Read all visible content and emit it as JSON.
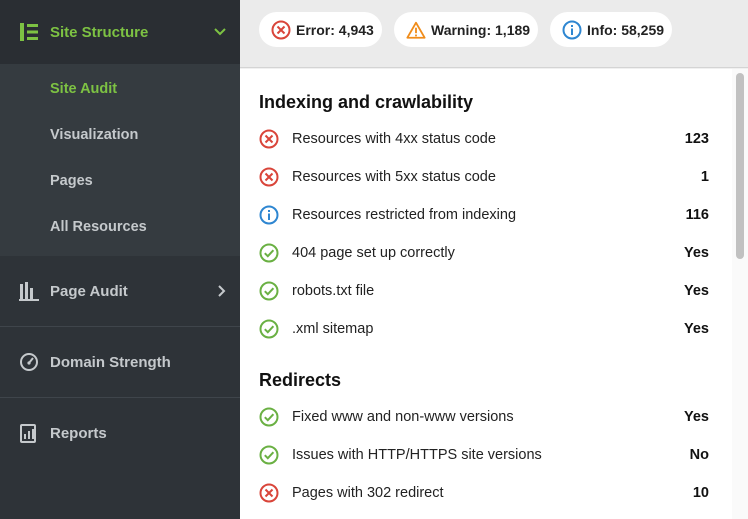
{
  "sidebar": {
    "site_structure": {
      "label": "Site Structure",
      "icon": "site-structure-icon",
      "expanded": true
    },
    "sub_items": [
      {
        "label": "Site Audit",
        "active": true
      },
      {
        "label": "Visualization",
        "active": false
      },
      {
        "label": "Pages",
        "active": false
      },
      {
        "label": "All Resources",
        "active": false
      }
    ],
    "page_audit": {
      "label": "Page Audit",
      "icon": "page-audit-icon"
    },
    "domain_strength": {
      "label": "Domain Strength",
      "icon": "gauge-icon"
    },
    "reports": {
      "label": "Reports",
      "icon": "reports-icon"
    }
  },
  "summary": {
    "error": {
      "label": "Error: 4,943",
      "color": "#d9453a"
    },
    "warning": {
      "label": "Warning: 1,189",
      "color": "#f08c1a"
    },
    "info": {
      "label": "Info: 58,259",
      "color": "#2e86d1"
    }
  },
  "groups": [
    {
      "title": "Indexing and crawlability",
      "rows": [
        {
          "status": "error",
          "label": "Resources with 4xx status code",
          "value": "123"
        },
        {
          "status": "error",
          "label": "Resources with 5xx status code",
          "value": "1"
        },
        {
          "status": "info",
          "label": "Resources restricted from indexing",
          "value": "116"
        },
        {
          "status": "ok",
          "label": "404 page set up correctly",
          "value": "Yes"
        },
        {
          "status": "ok",
          "label": "robots.txt file",
          "value": "Yes"
        },
        {
          "status": "ok",
          "label": ".xml sitemap",
          "value": "Yes"
        }
      ]
    },
    {
      "title": "Redirects",
      "rows": [
        {
          "status": "ok",
          "label": "Fixed www and non-www versions",
          "value": "Yes"
        },
        {
          "status": "ok",
          "label": "Issues with HTTP/HTTPS site versions",
          "value": "No"
        },
        {
          "status": "error",
          "label": "Pages with 302 redirect",
          "value": "10"
        }
      ]
    }
  ],
  "colors": {
    "accent": "#7dc243",
    "error": "#d9453a",
    "ok": "#6ab043",
    "info": "#2e86d1",
    "warning": "#f08c1a"
  }
}
